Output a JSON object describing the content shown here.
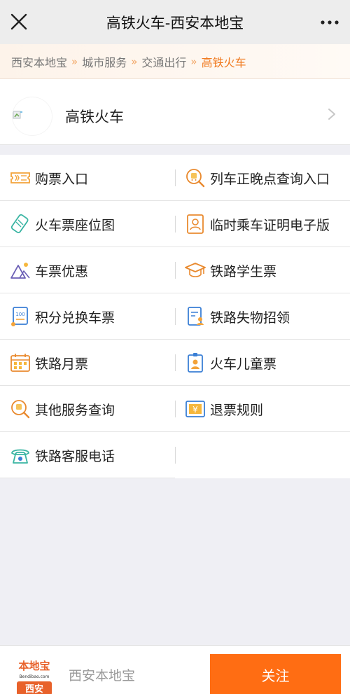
{
  "topbar": {
    "title": "高铁火车-西安本地宝",
    "close_icon": "close-icon",
    "more_icon": "more-icon"
  },
  "breadcrumb": {
    "items": [
      "西安本地宝",
      "城市服务",
      "交通出行"
    ],
    "active": "高铁火车",
    "separator": "»",
    "colors": {
      "active": "#f07a1f",
      "separator": "#f2a868"
    }
  },
  "header": {
    "label": "高铁火车",
    "image_icon": "broken-image-icon",
    "chevron_icon": "chevron-right-icon"
  },
  "menu": {
    "rows": [
      [
        {
          "label": "购票入口",
          "icon": "ticket-icon"
        },
        {
          "label": "列车正晚点查询入口",
          "icon": "search-train-icon"
        }
      ],
      [
        {
          "label": "火车票座位图",
          "icon": "seat-map-icon"
        },
        {
          "label": "临时乘车证明电子版",
          "icon": "id-person-icon"
        }
      ],
      [
        {
          "label": "车票优惠",
          "icon": "mountain-sun-icon"
        },
        {
          "label": "铁路学生票",
          "icon": "graduation-cap-icon"
        }
      ],
      [
        {
          "label": "积分兑换车票",
          "icon": "points-100-icon"
        },
        {
          "label": "铁路失物招领",
          "icon": "document-person-icon"
        }
      ],
      [
        {
          "label": "铁路月票",
          "icon": "calendar-icon"
        },
        {
          "label": "火车儿童票",
          "icon": "badge-person-icon"
        }
      ],
      [
        {
          "label": "其他服务查询",
          "icon": "search-magnify-icon"
        },
        {
          "label": "退票规则",
          "icon": "yuan-icon"
        }
      ],
      [
        {
          "label": "铁路客服电话",
          "icon": "phone-icon"
        },
        null
      ]
    ]
  },
  "footer": {
    "brand": "西安本地宝",
    "follow_label": "关注",
    "logo_text_top": "本地宝",
    "logo_text_mid": "Bendibao.com",
    "logo_text_bottom": "西安",
    "accent": "#ff6d13"
  }
}
